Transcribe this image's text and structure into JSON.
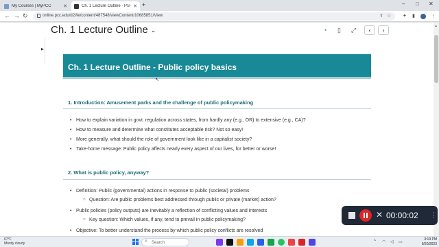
{
  "browser": {
    "tabs": [
      {
        "label": "My Courses | MyPCC",
        "active": false
      },
      {
        "label": "Ch. 1 Lecture Outline - PS-202-0...",
        "active": true
      }
    ],
    "new_tab_symbol": "+",
    "url": "online.pcc.edu/d2l/le/content/487548/viewContent/10685851/View",
    "window_controls": [
      "–",
      "□",
      "✕"
    ]
  },
  "page": {
    "topic_title": "Ch. 1 Lecture Outline",
    "title_chevron": "⌄",
    "banner_title": "Ch. 1 Lecture Outline - Public policy basics",
    "sections": [
      {
        "heading": "1. Introduction: Amusement parks and the challenge of public policymaking",
        "bullets": [
          "How to explain variation in govt. regulation across states, from hardly any (e.g., OR) to extensive (e.g., CA)?",
          "How to measure and determine what constitutes acceptable risk? Not so easy!",
          "More generally, what should the role of government look like in a capitalist society?",
          "Take-home message: Public policy affects nearly every aspect of our lives, for better or worse!"
        ]
      },
      {
        "heading": "2. What is public policy, anyway?",
        "bullets": [
          "Definition: Public (governmental) actions in response to public (societal) problems",
          "Question: Are public problems best addressed through public or private (market) action?",
          "Public policies (policy outputs) are inevitably a reflection of conflicting values and interests",
          "Key question: Which values, if any, tend to prevail in public policymaking?",
          "Objective: To better understand the process by which public policy conflicts are resolved"
        ]
      }
    ]
  },
  "recorder": {
    "elapsed": "00:00:02",
    "close_symbol": "✕",
    "menu_symbol": "⋮"
  },
  "taskbar": {
    "weather_temp": "67°F",
    "weather_desc": "Mostly cloudy",
    "search_placeholder": "Search",
    "time": "3:19 PM",
    "date": "9/20/2023"
  },
  "colors": {
    "banner": "#188996",
    "section_heading": "#1a6a76",
    "recorder_bg": "#1f2937",
    "recorder_pause": "#dc2626"
  },
  "icons": [
    "back-icon",
    "forward-icon",
    "reload-icon",
    "lock-icon",
    "share-icon",
    "star-icon",
    "extensions-icon",
    "profile-icon",
    "menu-icon",
    "bookmark-icon",
    "fullscreen-icon",
    "prev-icon",
    "next-icon",
    "start-icon",
    "search-icon"
  ]
}
